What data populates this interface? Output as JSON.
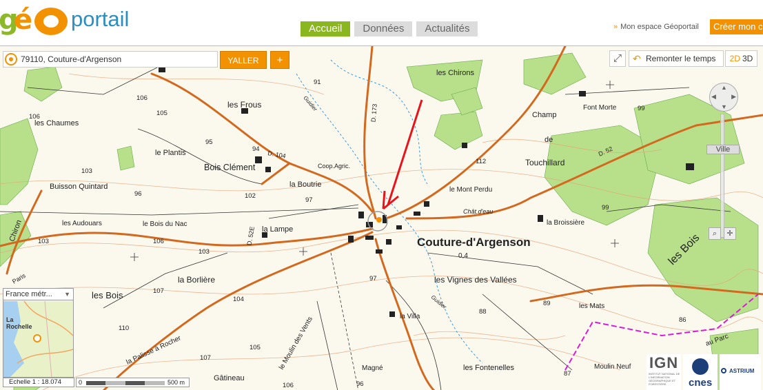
{
  "header": {
    "logo": {
      "g": "g",
      "e": "é",
      "portail": "portail"
    },
    "nav": [
      {
        "label": "Accueil"
      },
      {
        "label": "Données"
      },
      {
        "label": "Actualités"
      }
    ],
    "espace_label": "Mon espace Géoportail",
    "creer_label": "Créer mon c"
  },
  "search": {
    "value": "79110, Couture-d'Argenson",
    "go_label": "YALLER",
    "plus_label": "+"
  },
  "controls": {
    "fullscreen_glyph": "⤢",
    "remonter_label": "Remonter le temps",
    "mode_2d": "2D",
    "mode_3d": "3D",
    "zoom_level_label": "Ville"
  },
  "overview": {
    "projection": "France métr...",
    "city_label": "La Rochelle"
  },
  "scale": {
    "ratio_label": "Echelle 1 :  18.074",
    "start": "0",
    "end": "500 m"
  },
  "map_labels": {
    "chirons": "les Chirons",
    "frous": "les Frous",
    "chaumes": "les Chaumes",
    "plantis": "le Plantis",
    "bois_clement": "Bois Clément",
    "buisson_quintard": "Buisson Quintard",
    "boutrie": "la Boutrie",
    "coop": "Coop.Agric.",
    "audouars": "les Audouars",
    "bois_du_nac": "le Bois du Nac",
    "lampe": "la Lampe",
    "couture": "Couture-d'Argenson",
    "mont_perdu": "le Mont Perdu",
    "chat_eau": "Chât.d'eau",
    "broissiere": "la Broissière",
    "champ": "Champ",
    "de": "de",
    "touchillard": "Touchillard",
    "font_morte": "Font Morte",
    "les_bois_right": "les Bois",
    "vignes": "les Vignes des Vallées",
    "borliere": "la Borlière",
    "les_bois_left": "les Bois",
    "villa": "la Villa",
    "mats": "les Mats",
    "au_parc": "au Parc",
    "moulin_vents": "le Moulin des Vents",
    "palisse": "la Palisse à Rocher",
    "gatineau": "Gâtineau",
    "magne": "Magné",
    "fontenelles": "les Fontenelles",
    "moulin_neuf": "Moulin Neuf",
    "chiron": "Chiron",
    "paris": "Paris",
    "guidier": "Guidier",
    "guidier2": "Guidier",
    "d104": "D. 104",
    "d52e": "D. 52E",
    "d52": "D. 52",
    "d173": "D. 173",
    "zero4": "0,4",
    "h106a": "106",
    "h105": "105",
    "h106b": "106",
    "h103": "103",
    "h96": "96",
    "h102": "102",
    "h97": "97",
    "h103b": "103",
    "h106c": "106",
    "h103c": "103",
    "h107": "107",
    "h104": "104",
    "h110": "110",
    "h107b": "107",
    "h105b": "105",
    "h106d": "106",
    "h96b": "96",
    "h97b": "97",
    "h88": "88",
    "h89": "89",
    "h87": "87",
    "h112": "112",
    "h91": "91",
    "h99": "99",
    "h99b": "99",
    "h95": "95",
    "h94": "94",
    "h86": "86"
  },
  "logos": {
    "ign": "IGN",
    "ign_sub": "INSTITUT NATIONAL DE L'INFORMATION GÉOGRAPHIQUE ET FORESTIÈRE",
    "cnes": "cnes",
    "astrium": "ASTRIUM"
  },
  "colors": {
    "accent_orange": "#f39200",
    "nav_active_green": "#8ab61f",
    "logo_blue": "#2b8ec0",
    "road_orange": "#d2691e",
    "forest_green": "#b8e08a",
    "arrow_red": "#e8141c",
    "boundary_magenta": "#d81bd8"
  }
}
